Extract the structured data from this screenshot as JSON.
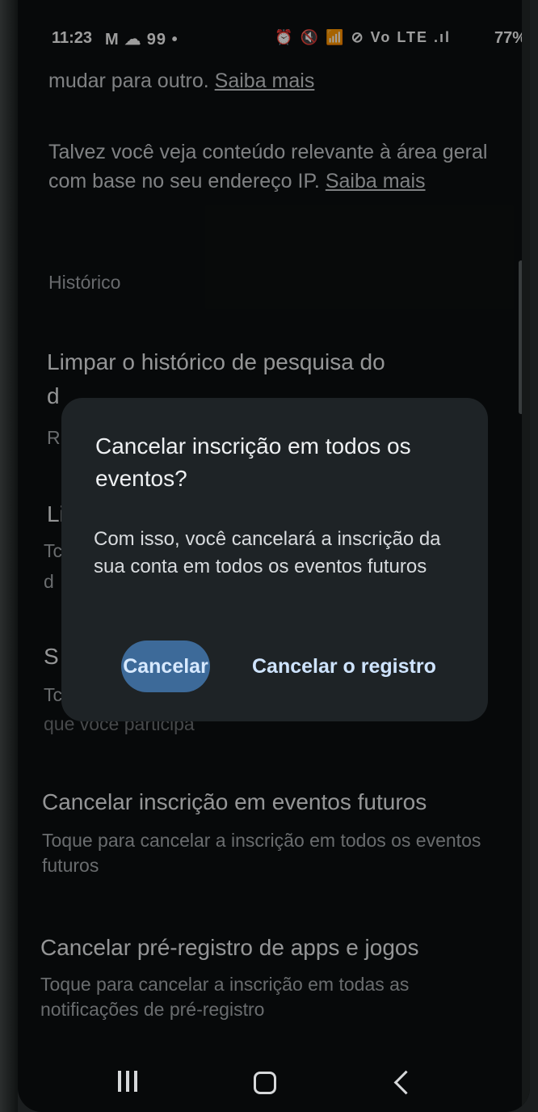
{
  "status_bar": {
    "time": "11:23",
    "notifications": "M ☁ 99 •",
    "system_icons": "⏰ 🔇 📶 ⊘ Vo LTE .ıl",
    "battery": "77%"
  },
  "background": {
    "country_text_tail": "mudar para outro.",
    "learn_more_1": "Saiba mais",
    "ip_text": "Talvez você veja conteúdo relevante à área geral com base no seu endereço IP.",
    "learn_more_2": "Saiba mais",
    "history_section": "Histórico",
    "clear_history_title": "Limpar o histórico de pesquisa do",
    "clear_history_title_cont": "d",
    "partial_r": "R",
    "partial_li": "Li",
    "partial_tc1": "Tc",
    "partial_d": "d",
    "partial_s": "S",
    "partial_tc2": "Tc",
    "participate_text": "que você participa",
    "unsubscribe_future_title": "Cancelar inscrição em eventos futuros",
    "unsubscribe_future_sub": "Toque para cancelar a inscrição em todos os eventos futuros",
    "prereg_title": "Cancelar pré-registro de apps e jogos",
    "prereg_sub": "Toque para cancelar a inscrição em todas as notificações de pré-registro"
  },
  "dialog": {
    "title": "Cancelar inscrição em todos os eventos?",
    "body": "Com isso, você cancelará a inscrição da sua conta em todos os eventos futuros",
    "cancel_button": "Cancelar",
    "confirm_button": "Cancelar o registro"
  },
  "colors": {
    "dialog_bg": "#1e2326",
    "cancel_button_bg": "#3d6a99",
    "button_text": "#cfe4ff"
  }
}
